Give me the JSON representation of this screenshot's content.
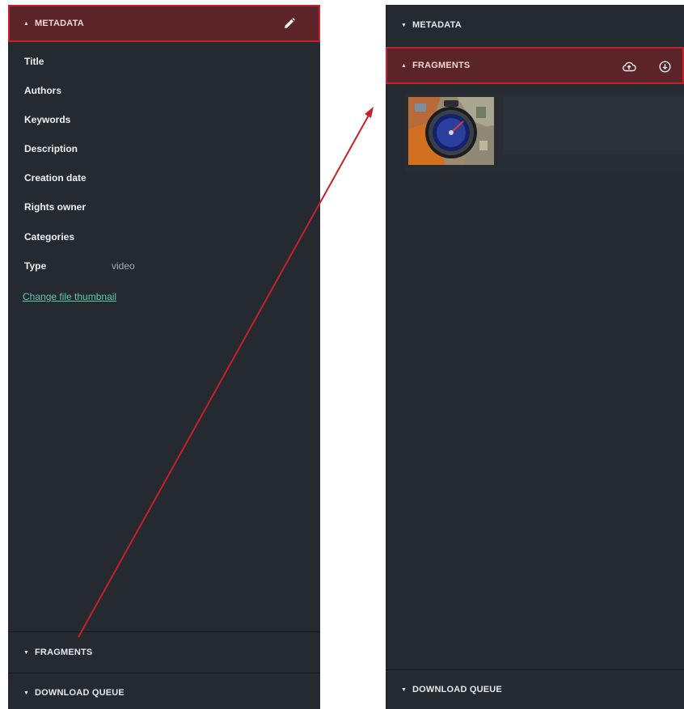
{
  "left_panel": {
    "metadata_header": "METADATA",
    "fields": [
      {
        "label": "Title",
        "value": ""
      },
      {
        "label": "Authors",
        "value": ""
      },
      {
        "label": "Keywords",
        "value": ""
      },
      {
        "label": "Description",
        "value": ""
      },
      {
        "label": "Creation date",
        "value": ""
      },
      {
        "label": "Rights owner",
        "value": ""
      },
      {
        "label": "Categories",
        "value": ""
      },
      {
        "label": "Type",
        "value": "video"
      }
    ],
    "change_thumbnail_link": "Change file thumbnail",
    "fragments_header": "FRAGMENTS",
    "download_queue_header": "DOWNLOAD QUEUE"
  },
  "right_panel": {
    "metadata_header": "METADATA",
    "fragments_header": "FRAGMENTS",
    "download_queue_header": "DOWNLOAD QUEUE"
  },
  "icons": {
    "edit": "pencil-icon",
    "upload": "cloud-upload-icon",
    "download": "download-circle-icon",
    "expand": "caret-down-icon",
    "collapse": "caret-up-icon"
  },
  "colors": {
    "panel_bg": "#242a30",
    "active_header_bg": "#5a2428",
    "highlight_border": "#c8202a",
    "link": "#5fc9a4",
    "arrow": "#c8202a"
  }
}
